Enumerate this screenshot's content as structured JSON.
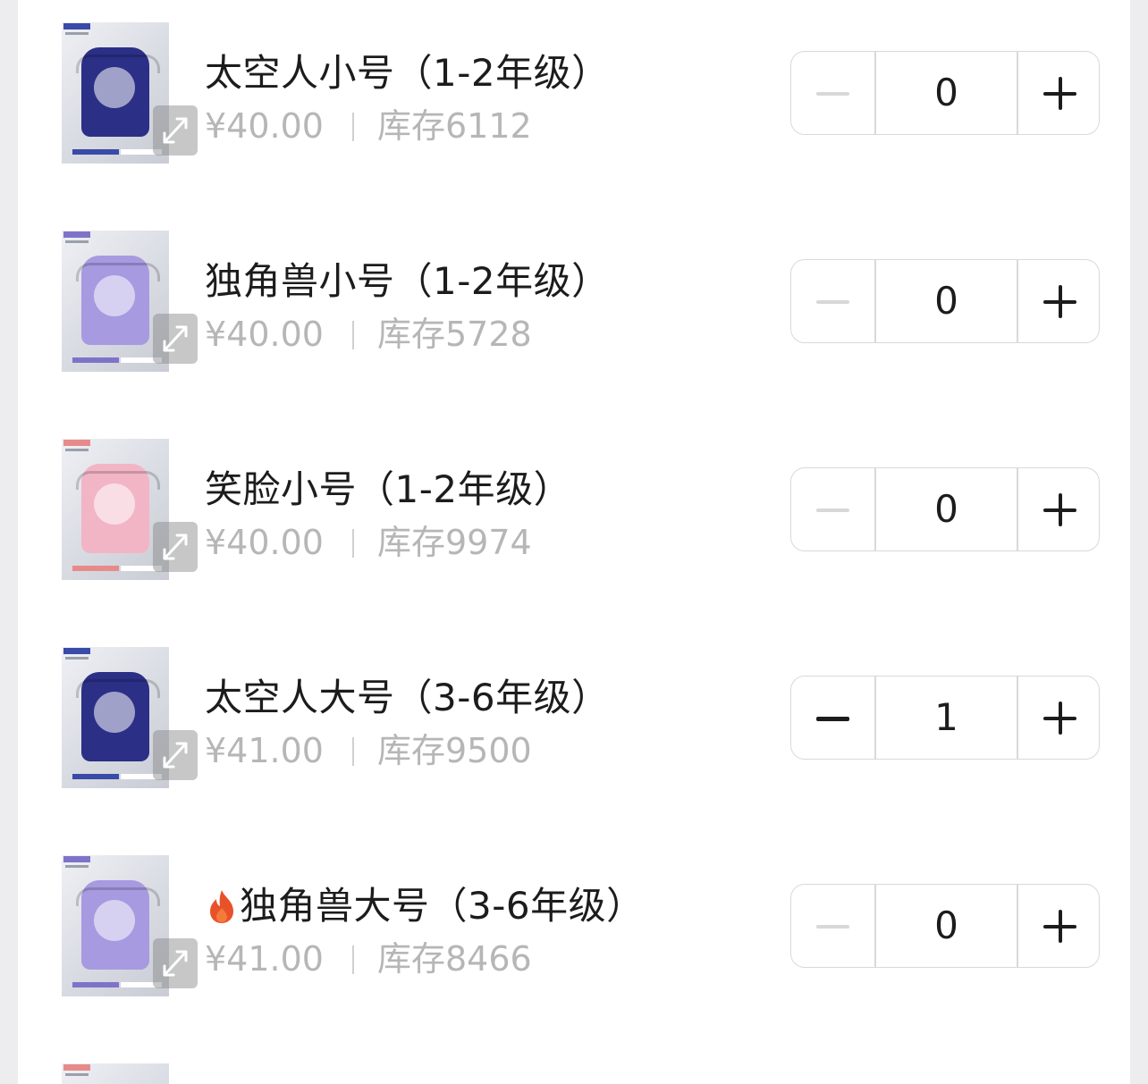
{
  "items": [
    {
      "name": "太空人小号（1-2年级）",
      "hot": false,
      "price": "¥40.00",
      "stock": "库存6112",
      "qty": "0",
      "minus_enabled": false,
      "bag_color": "#2b2f86",
      "tag_color": "#3a4aa8"
    },
    {
      "name": "独角兽小号（1-2年级）",
      "hot": false,
      "price": "¥40.00",
      "stock": "库存5728",
      "qty": "0",
      "minus_enabled": false,
      "bag_color": "#a79ae0",
      "tag_color": "#7d74c9"
    },
    {
      "name": "笑脸小号（1-2年级）",
      "hot": false,
      "price": "¥40.00",
      "stock": "库存9974",
      "qty": "0",
      "minus_enabled": false,
      "bag_color": "#f2b5c6",
      "tag_color": "#e88a8a"
    },
    {
      "name": "太空人大号（3-6年级）",
      "hot": false,
      "price": "¥41.00",
      "stock": "库存9500",
      "qty": "1",
      "minus_enabled": true,
      "bag_color": "#2b2f86",
      "tag_color": "#3a4aa8"
    },
    {
      "name": "独角兽大号（3-6年级）",
      "hot": true,
      "price": "¥41.00",
      "stock": "库存8466",
      "qty": "0",
      "minus_enabled": false,
      "bag_color": "#a79ae0",
      "tag_color": "#7d74c9"
    }
  ],
  "colors": {
    "text": "#1c1c1c",
    "muted": "#b6b6b6",
    "border": "#d9d9d9",
    "fire": "#e8522b"
  },
  "icons": {
    "expand": "expand-icon",
    "minus": "minus-icon",
    "plus": "plus-icon",
    "hot": "fire-icon"
  }
}
